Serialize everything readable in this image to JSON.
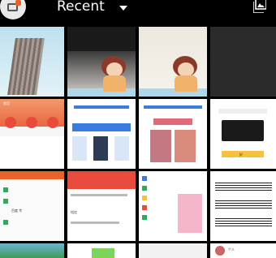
{
  "header": {
    "title": "Recent",
    "app_icon": "photos-app-icon",
    "dropdown_icon": "caret-down-icon",
    "image_icon": "image-icon"
  },
  "colors": {
    "background": "#000000",
    "header_text": "#ffffff",
    "accent_orange": "#e8622a",
    "accent_red": "#e84b3c",
    "accent_blue": "#3b7be0",
    "accent_yellow": "#f5c33b"
  },
  "thumbnails": [
    {
      "name": "skyscraper-photo"
    },
    {
      "name": "girl-illustration-dark"
    },
    {
      "name": "girl-illustration"
    },
    {
      "name": "dark-screenshot"
    },
    {
      "name": "app-home-screenshot",
      "text": "首页"
    },
    {
      "name": "blue-banner-screenshot"
    },
    {
      "name": "pink-cards-screenshot"
    },
    {
      "name": "blank-screenshot",
      "text": "Hi Ray"
    },
    {
      "name": "popup-screenshot",
      "text": "好"
    },
    {
      "name": "settings-list-screenshot",
      "text": "百度 专"
    },
    {
      "name": "red-dialog-screenshot",
      "text": "短信"
    },
    {
      "name": "color-list-screenshot"
    },
    {
      "name": "sheet-music-screenshot"
    },
    {
      "name": "landscape-photo"
    },
    {
      "name": "green-screenshot"
    },
    {
      "name": "partial-screenshot"
    },
    {
      "name": "profile-screenshot",
      "text": "个人"
    }
  ]
}
